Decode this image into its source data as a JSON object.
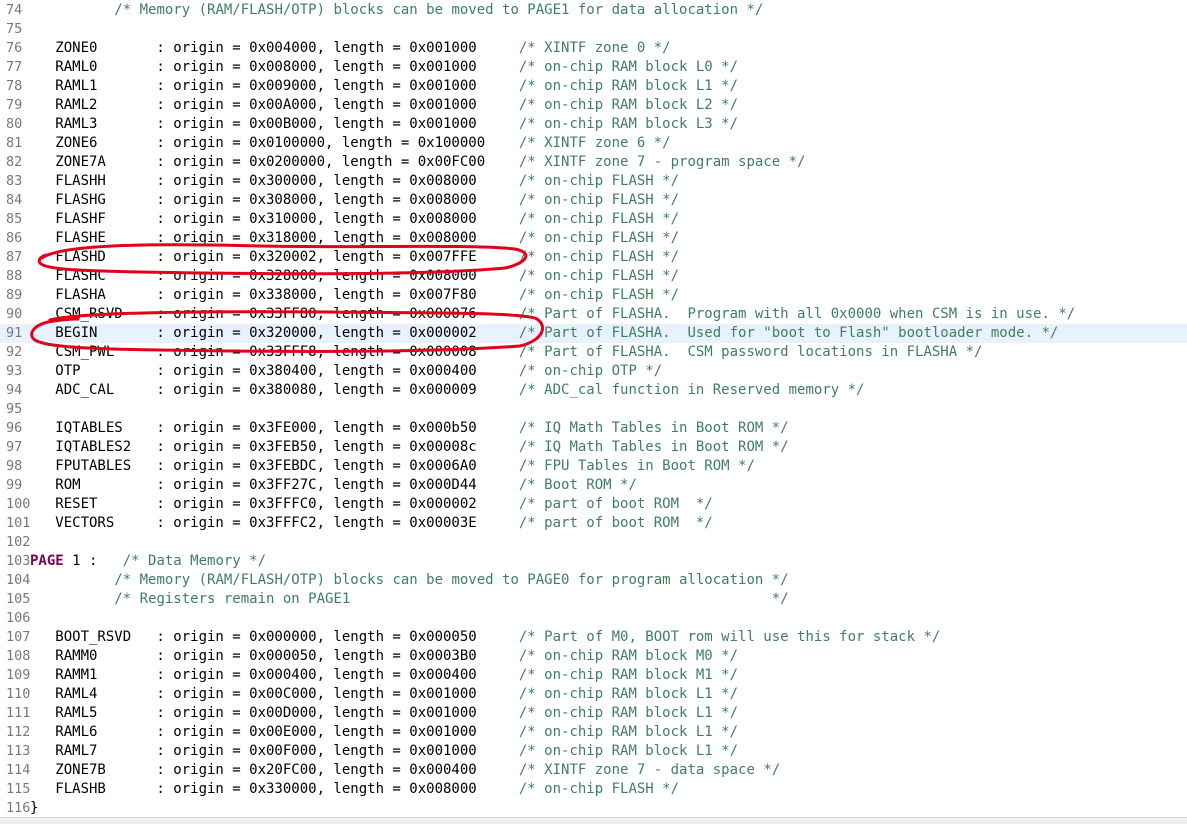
{
  "editor": {
    "highlighted_line": "91",
    "lines": [
      {
        "num": "74",
        "code": "          ",
        "comment": "/* Memory (RAM/FLASH/OTP) blocks can be moved to PAGE1 for data allocation */"
      },
      {
        "num": "75",
        "code": "",
        "comment": ""
      },
      {
        "num": "76",
        "code": "   ZONE0       : origin = 0x004000, length = 0x001000     ",
        "comment": "/* XINTF zone 0 */"
      },
      {
        "num": "77",
        "code": "   RAML0       : origin = 0x008000, length = 0x001000     ",
        "comment": "/* on-chip RAM block L0 */"
      },
      {
        "num": "78",
        "code": "   RAML1       : origin = 0x009000, length = 0x001000     ",
        "comment": "/* on-chip RAM block L1 */"
      },
      {
        "num": "79",
        "code": "   RAML2       : origin = 0x00A000, length = 0x001000     ",
        "comment": "/* on-chip RAM block L2 */"
      },
      {
        "num": "80",
        "code": "   RAML3       : origin = 0x00B000, length = 0x001000     ",
        "comment": "/* on-chip RAM block L3 */"
      },
      {
        "num": "81",
        "code": "   ZONE6       : origin = 0x0100000, length = 0x100000    ",
        "comment": "/* XINTF zone 6 */"
      },
      {
        "num": "82",
        "code": "   ZONE7A      : origin = 0x0200000, length = 0x00FC00    ",
        "comment": "/* XINTF zone 7 - program space */"
      },
      {
        "num": "83",
        "code": "   FLASHH      : origin = 0x300000, length = 0x008000     ",
        "comment": "/* on-chip FLASH */"
      },
      {
        "num": "84",
        "code": "   FLASHG      : origin = 0x308000, length = 0x008000     ",
        "comment": "/* on-chip FLASH */"
      },
      {
        "num": "85",
        "code": "   FLASHF      : origin = 0x310000, length = 0x008000     ",
        "comment": "/* on-chip FLASH */"
      },
      {
        "num": "86",
        "code": "   FLASHE      : origin = 0x318000, length = 0x008000     ",
        "comment": "/* on-chip FLASH */"
      },
      {
        "num": "87",
        "code": "   FLASHD      : origin = 0x320002, length = 0x007FFE     ",
        "comment": "/* on-chip FLASH */"
      },
      {
        "num": "88",
        "code": "   FLASHC      : origin = 0x328000, length = 0x008000     ",
        "comment": "/* on-chip FLASH */"
      },
      {
        "num": "89",
        "code": "   FLASHA      : origin = 0x338000, length = 0x007F80     ",
        "comment": "/* on-chip FLASH */"
      },
      {
        "num": "90",
        "code": "   CSM_RSVD    : origin = 0x33FF80, length = 0x000076     ",
        "comment": "/* Part of FLASHA.  Program with all 0x0000 when CSM is in use. */"
      },
      {
        "num": "91",
        "code": "   BEGIN       : origin = 0x320000, length = 0x000002     ",
        "comment": "/* Part of FLASHA.  Used for \"boot to Flash\" bootloader mode. */"
      },
      {
        "num": "92",
        "code": "   CSM_PWL     : origin = 0x33FFF8, length = 0x000008     ",
        "comment": "/* Part of FLASHA.  CSM password locations in FLASHA */"
      },
      {
        "num": "93",
        "code": "   OTP         : origin = 0x380400, length = 0x000400     ",
        "comment": "/* on-chip OTP */"
      },
      {
        "num": "94",
        "code": "   ADC_CAL     : origin = 0x380080, length = 0x000009     ",
        "comment": "/* ADC_cal function in Reserved memory */"
      },
      {
        "num": "95",
        "code": "",
        "comment": ""
      },
      {
        "num": "96",
        "code": "   IQTABLES    : origin = 0x3FE000, length = 0x000b50     ",
        "comment": "/* IQ Math Tables in Boot ROM */"
      },
      {
        "num": "97",
        "code": "   IQTABLES2   : origin = 0x3FEB50, length = 0x00008c     ",
        "comment": "/* IQ Math Tables in Boot ROM */"
      },
      {
        "num": "98",
        "code": "   FPUTABLES   : origin = 0x3FEBDC, length = 0x0006A0     ",
        "comment": "/* FPU Tables in Boot ROM */"
      },
      {
        "num": "99",
        "code": "   ROM         : origin = 0x3FF27C, length = 0x000D44     ",
        "comment": "/* Boot ROM */"
      },
      {
        "num": "100",
        "code": "   RESET       : origin = 0x3FFFC0, length = 0x000002     ",
        "comment": "/* part of boot ROM  */"
      },
      {
        "num": "101",
        "code": "   VECTORS     : origin = 0x3FFFC2, length = 0x00003E     ",
        "comment": "/* part of boot ROM  */"
      },
      {
        "num": "102",
        "code": "",
        "comment": ""
      },
      {
        "num": "103",
        "keyword": "PAGE",
        "code": " 1 :   ",
        "comment": "/* Data Memory */"
      },
      {
        "num": "104",
        "code": "          ",
        "comment": "/* Memory (RAM/FLASH/OTP) blocks can be moved to PAGE0 for program allocation */"
      },
      {
        "num": "105",
        "code": "          ",
        "comment": "/* Registers remain on PAGE1                                                  */"
      },
      {
        "num": "106",
        "code": "",
        "comment": ""
      },
      {
        "num": "107",
        "code": "   BOOT_RSVD   : origin = 0x000000, length = 0x000050     ",
        "comment": "/* Part of M0, BOOT rom will use this for stack */"
      },
      {
        "num": "108",
        "code": "   RAMM0       : origin = 0x000050, length = 0x0003B0     ",
        "comment": "/* on-chip RAM block M0 */"
      },
      {
        "num": "109",
        "code": "   RAMM1       : origin = 0x000400, length = 0x000400     ",
        "comment": "/* on-chip RAM block M1 */"
      },
      {
        "num": "110",
        "code": "   RAML4       : origin = 0x00C000, length = 0x001000     ",
        "comment": "/* on-chip RAM block L1 */"
      },
      {
        "num": "111",
        "code": "   RAML5       : origin = 0x00D000, length = 0x001000     ",
        "comment": "/* on-chip RAM block L1 */"
      },
      {
        "num": "112",
        "code": "   RAML6       : origin = 0x00E000, length = 0x001000     ",
        "comment": "/* on-chip RAM block L1 */"
      },
      {
        "num": "113",
        "code": "   RAML7       : origin = 0x00F000, length = 0x001000     ",
        "comment": "/* on-chip RAM block L1 */"
      },
      {
        "num": "114",
        "code": "   ZONE7B      : origin = 0x20FC00, length = 0x000400     ",
        "comment": "/* XINTF zone 7 - data space */"
      },
      {
        "num": "115",
        "code": "   FLASHB      : origin = 0x330000, length = 0x008000     ",
        "comment": "/* on-chip FLASH */"
      },
      {
        "num": "116",
        "code": "}",
        "comment": ""
      }
    ]
  },
  "annotations": {
    "color": "#e3001b",
    "marks": [
      "FLASHD line circled",
      "BEGIN line circled"
    ]
  }
}
